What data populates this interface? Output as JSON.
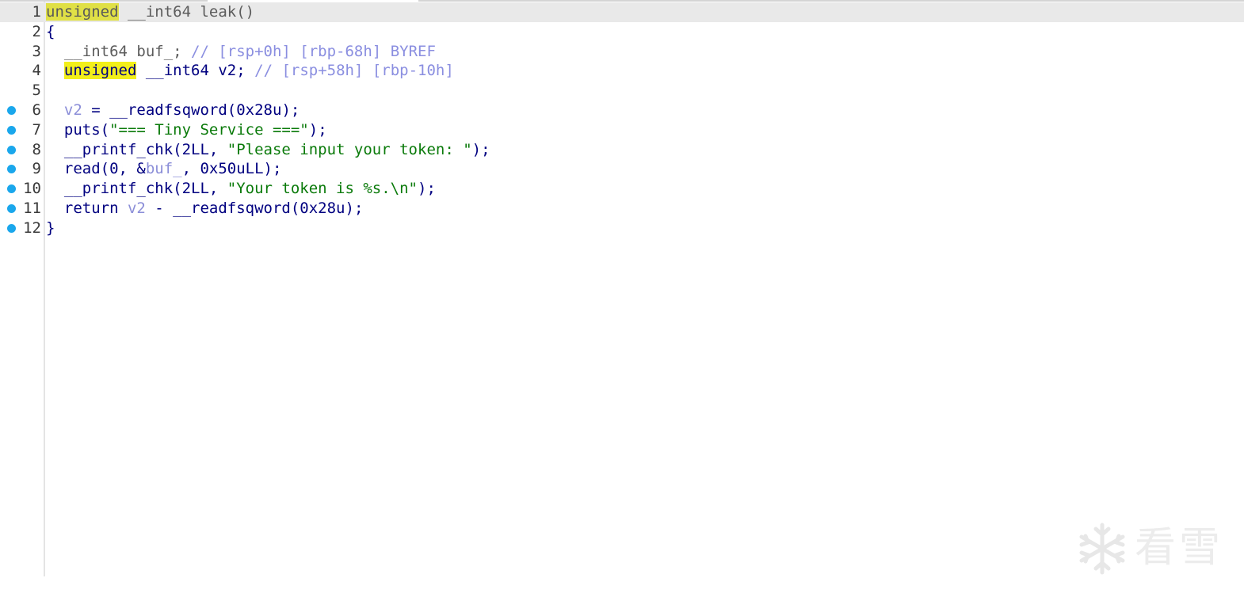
{
  "editor": {
    "lines": [
      {
        "num": "1",
        "breakpoint": false,
        "current": true,
        "tokens": [
          {
            "t": "unsigned",
            "c": "hl"
          },
          {
            "t": " __int64 leak()",
            "c": "gray"
          }
        ]
      },
      {
        "num": "2",
        "breakpoint": false,
        "current": false,
        "tokens": [
          {
            "t": "{",
            "c": "kw"
          }
        ]
      },
      {
        "num": "3",
        "breakpoint": false,
        "current": false,
        "tokens": [
          {
            "t": "  __int64 buf_; ",
            "c": "gray"
          },
          {
            "t": "// [rsp+0h] [rbp-68h] BYREF",
            "c": "cmt"
          }
        ]
      },
      {
        "num": "4",
        "breakpoint": false,
        "current": false,
        "tokens": [
          {
            "t": "  ",
            "c": "kw"
          },
          {
            "t": "unsigned",
            "c": "hl"
          },
          {
            "t": " __int64 v2; ",
            "c": "kw"
          },
          {
            "t": "// [rsp+58h] [rbp-10h]",
            "c": "cmt"
          }
        ]
      },
      {
        "num": "5",
        "breakpoint": false,
        "current": false,
        "tokens": []
      },
      {
        "num": "6",
        "breakpoint": true,
        "current": false,
        "tokens": [
          {
            "t": "  ",
            "c": "kw"
          },
          {
            "t": "v2",
            "c": "var"
          },
          {
            "t": " = __readfsqword(0x28u);",
            "c": "kw"
          }
        ]
      },
      {
        "num": "7",
        "breakpoint": true,
        "current": false,
        "tokens": [
          {
            "t": "  puts(",
            "c": "kw"
          },
          {
            "t": "\"=== Tiny Service ===\"",
            "c": "str"
          },
          {
            "t": ");",
            "c": "kw"
          }
        ]
      },
      {
        "num": "8",
        "breakpoint": true,
        "current": false,
        "tokens": [
          {
            "t": "  __printf_chk(2LL, ",
            "c": "kw"
          },
          {
            "t": "\"Please input your token: \"",
            "c": "str"
          },
          {
            "t": ");",
            "c": "kw"
          }
        ]
      },
      {
        "num": "9",
        "breakpoint": true,
        "current": false,
        "tokens": [
          {
            "t": "  read(0, &",
            "c": "kw"
          },
          {
            "t": "buf_",
            "c": "var"
          },
          {
            "t": ", 0x50uLL);",
            "c": "kw"
          }
        ]
      },
      {
        "num": "10",
        "breakpoint": true,
        "current": false,
        "tokens": [
          {
            "t": "  __printf_chk(2LL, ",
            "c": "kw"
          },
          {
            "t": "\"Your token is %s.\\n\"",
            "c": "str"
          },
          {
            "t": ");",
            "c": "kw"
          }
        ]
      },
      {
        "num": "11",
        "breakpoint": true,
        "current": false,
        "tokens": [
          {
            "t": "  return ",
            "c": "kw"
          },
          {
            "t": "v2",
            "c": "var"
          },
          {
            "t": " - __readfsqword(0x28u);",
            "c": "kw"
          }
        ]
      },
      {
        "num": "12",
        "breakpoint": true,
        "current": false,
        "tokens": [
          {
            "t": "}",
            "c": "kw"
          }
        ]
      }
    ]
  },
  "watermark": {
    "text": "看雪",
    "icon": "snowflake-icon"
  },
  "colors": {
    "keyword": "#000080",
    "variable": "#8b8ed8",
    "comment": "#8a8ee0",
    "string": "#0a7a0a",
    "highlight": "#f2ef1a",
    "breakpoint": "#1aa7ec"
  }
}
